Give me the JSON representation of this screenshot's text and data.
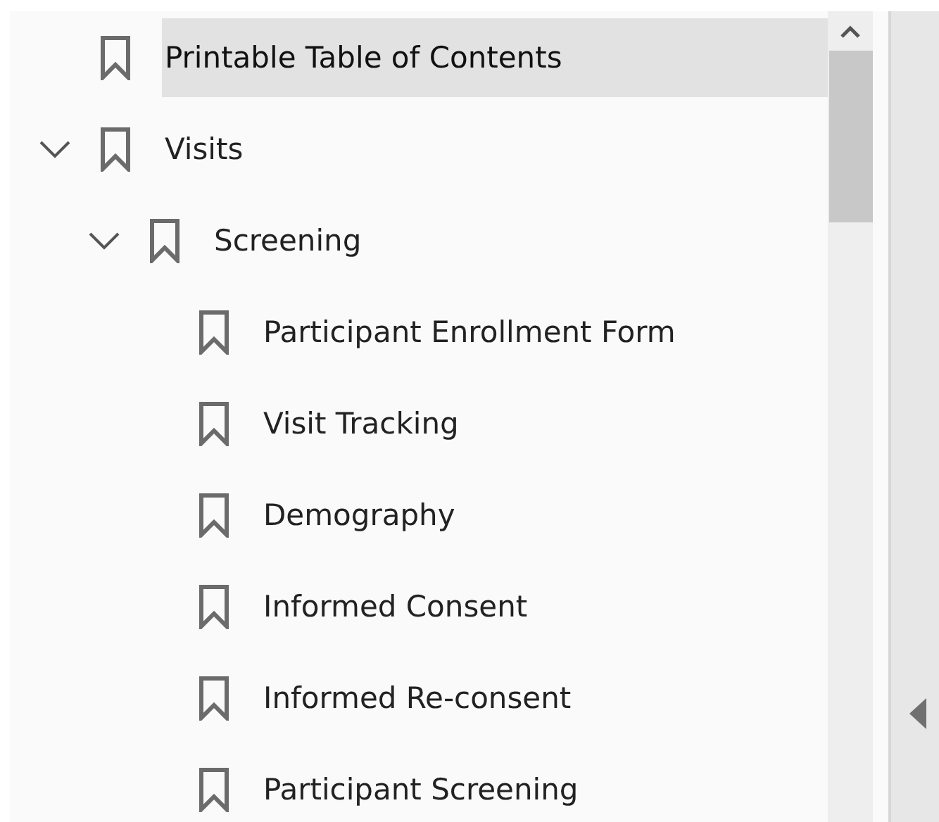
{
  "bookmarks": [
    {
      "label": "Printable Table of Contents",
      "selected": true
    },
    {
      "label": "Visits",
      "selected": false,
      "expanded": true,
      "children": [
        {
          "label": "Screening",
          "selected": false,
          "expanded": true,
          "children": [
            {
              "label": "Participant Enrollment Form",
              "selected": false
            },
            {
              "label": "Visit Tracking",
              "selected": false
            },
            {
              "label": "Demography",
              "selected": false
            },
            {
              "label": "Informed Consent",
              "selected": false
            },
            {
              "label": "Informed Re-consent",
              "selected": false
            },
            {
              "label": "Participant Screening",
              "selected": false
            }
          ]
        }
      ]
    }
  ]
}
